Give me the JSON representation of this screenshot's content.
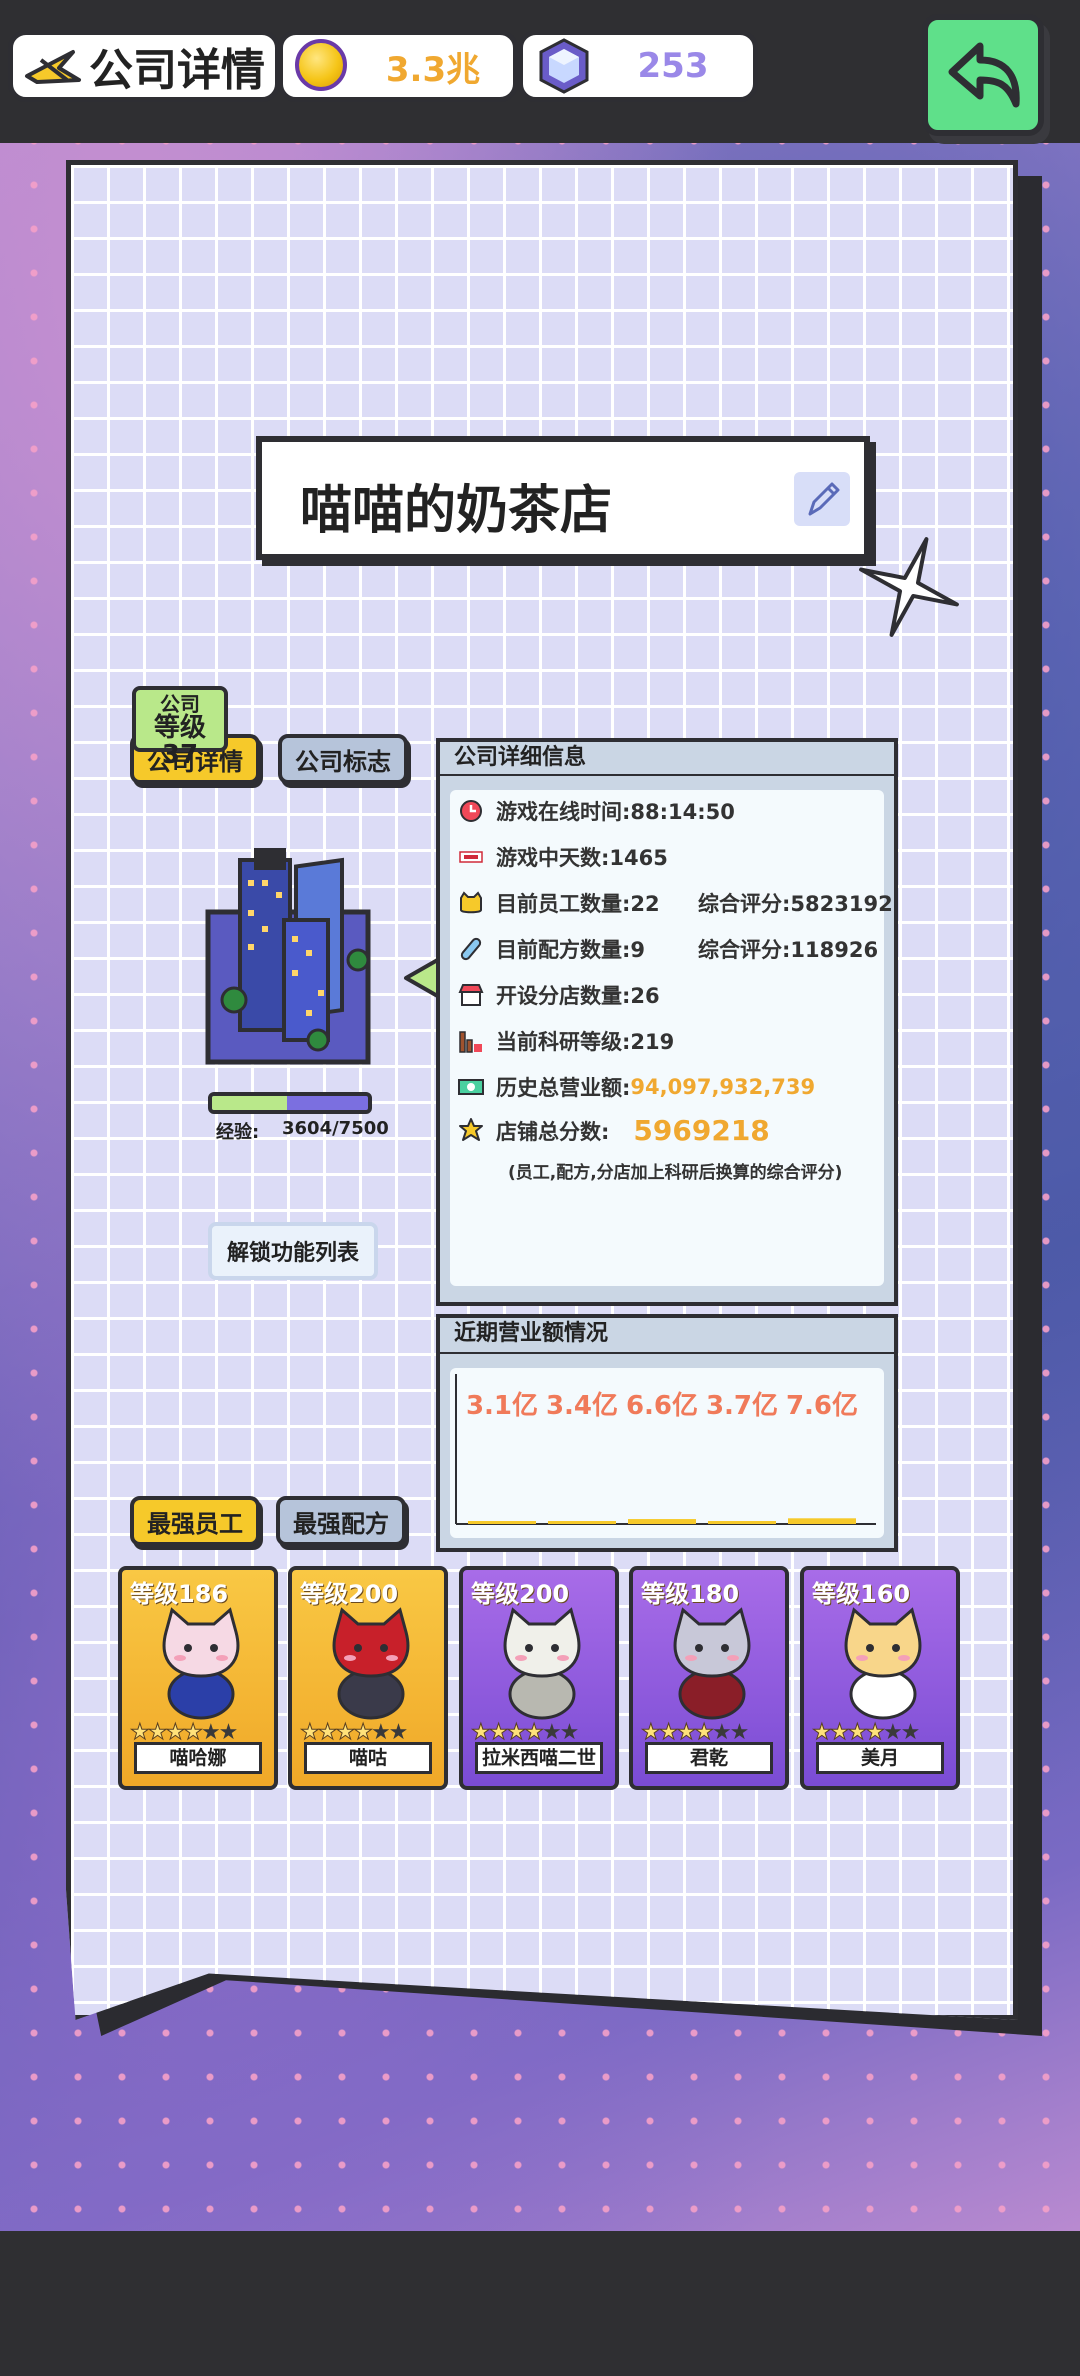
{
  "header": {
    "title": "公司详情",
    "coins": "3.3兆",
    "gems": "253"
  },
  "shop": {
    "name": "喵喵的奶茶店"
  },
  "company_tabs": {
    "details": "公司详情",
    "logo": "公司标志"
  },
  "company": {
    "level_label": "公司",
    "level": "等级37",
    "exp_label": "经验:",
    "exp_value": "3604/7500",
    "exp_fraction": 0.48,
    "unlock_label": "解锁功能列表"
  },
  "details_panel": {
    "title": "公司详细信息",
    "online_time": "游戏在线时间:88:14:50",
    "game_days": "游戏中天数:1465",
    "employees": "目前员工数量:22",
    "employees_score": "综合评分:5823192",
    "recipes": "目前配方数量:9",
    "recipes_score": "综合评分:118926",
    "branches": "开设分店数量:26",
    "research_level": "当前科研等级:219",
    "revenue_label": "历史总营业额:",
    "revenue_value": "94,097,932,739",
    "store_score_label": "店铺总分数:",
    "store_score_value": "5969218",
    "note": "(员工,配方,分店加上科研后换算的综合评分)"
  },
  "revenue_panel": {
    "title": "近期营业额情况"
  },
  "chart_data": {
    "type": "bar",
    "categories": [
      "",
      "",
      "",
      "",
      ""
    ],
    "values": [
      3.1,
      3.4,
      6.6,
      3.7,
      7.6
    ],
    "labels": [
      "3.1亿",
      "3.4亿",
      "6.6亿",
      "3.7亿",
      "7.6亿"
    ],
    "title": "近期营业额情况",
    "xlabel": "",
    "ylabel": "",
    "ylim": [
      0,
      200
    ]
  },
  "staff_tabs": {
    "employees": "最强员工",
    "recipes": "最强配方"
  },
  "employees": [
    {
      "level": "等级186",
      "name": "喵哈娜",
      "stars": 4,
      "rarity": "gold",
      "colors": [
        "#f6d9e4",
        "#2b3fa8"
      ]
    },
    {
      "level": "等级200",
      "name": "喵咕",
      "stars": 4,
      "rarity": "gold",
      "colors": [
        "#c8202a",
        "#3a3a4a"
      ]
    },
    {
      "level": "等级200",
      "name": "拉米西喵二世",
      "stars": 4,
      "rarity": "purple",
      "colors": [
        "#f0f0ea",
        "#b8b8b0"
      ]
    },
    {
      "level": "等级180",
      "name": "君乾",
      "stars": 4,
      "rarity": "purple",
      "colors": [
        "#c8c8d8",
        "#8a1e28"
      ]
    },
    {
      "level": "等级160",
      "name": "美月",
      "stars": 4,
      "rarity": "purple",
      "colors": [
        "#f8d68a",
        "#ffffff"
      ]
    }
  ]
}
